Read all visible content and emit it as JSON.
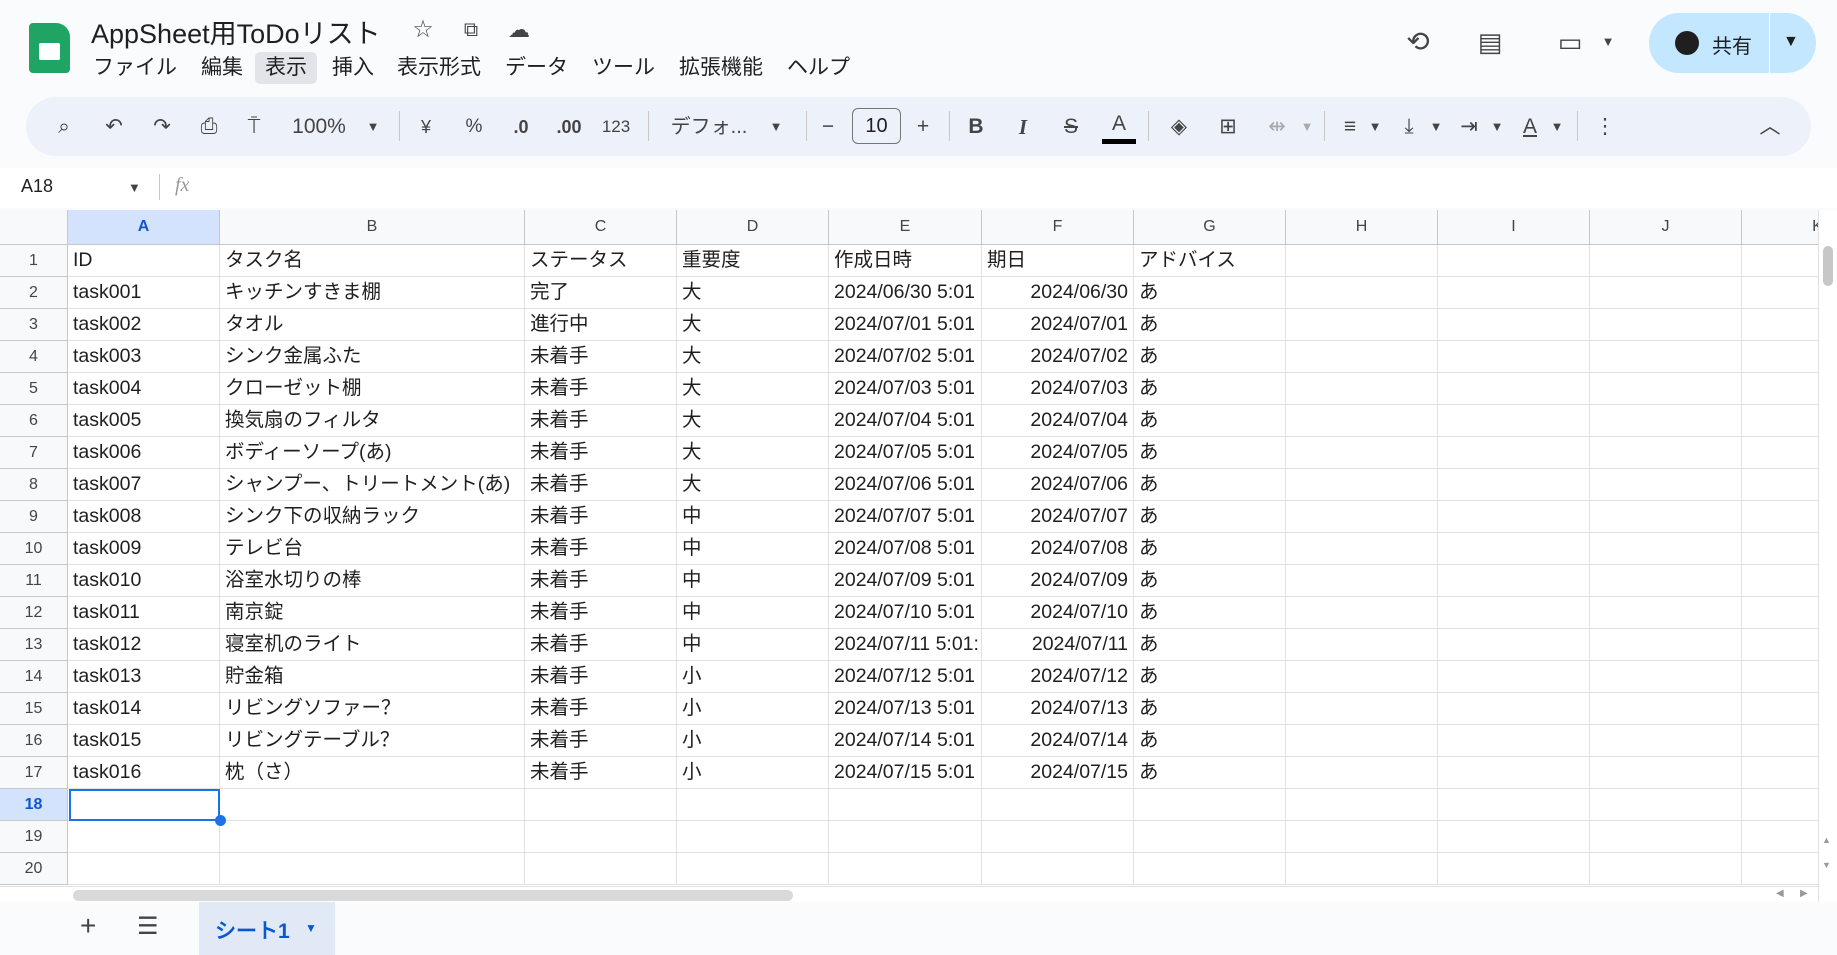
{
  "app": {
    "title": "AppSheet用ToDoリスト",
    "share_label": "共有"
  },
  "menu": [
    "ファイル",
    "編集",
    "表示",
    "挿入",
    "表示形式",
    "データ",
    "ツール",
    "拡張機能",
    "ヘルプ"
  ],
  "toolbar": {
    "zoom": "100%",
    "currency": "¥",
    "percent": "%",
    "dec_decrease": ".0",
    "dec_increase": ".00",
    "number_format": "123",
    "font": "デフォ...",
    "font_size": "10",
    "bold": "B",
    "italic": "I",
    "text_color": "A"
  },
  "formula_bar": {
    "cell_ref": "A18",
    "fx": "fx",
    "value": ""
  },
  "columns": [
    "A",
    "B",
    "C",
    "D",
    "E",
    "F",
    "G",
    "H",
    "I",
    "J",
    "K"
  ],
  "row_numbers": [
    "1",
    "2",
    "3",
    "4",
    "5",
    "6",
    "7",
    "8",
    "9",
    "10",
    "11",
    "12",
    "13",
    "14",
    "15",
    "16",
    "17",
    "18",
    "19",
    "20"
  ],
  "rows": [
    [
      "ID",
      "タスク名",
      "ステータス",
      "重要度",
      "作成日時",
      "期日",
      "アドバイス"
    ],
    [
      "task001",
      "キッチンすきま棚",
      "完了",
      "大",
      "2024/06/30 5:01",
      "2024/06/30",
      "あ"
    ],
    [
      "task002",
      "タオル",
      "進行中",
      "大",
      "2024/07/01 5:01",
      "2024/07/01",
      "あ"
    ],
    [
      "task003",
      "シンク金属ふた",
      "未着手",
      "大",
      "2024/07/02 5:01",
      "2024/07/02",
      "あ"
    ],
    [
      "task004",
      "クローゼット棚",
      "未着手",
      "大",
      "2024/07/03 5:01",
      "2024/07/03",
      "あ"
    ],
    [
      "task005",
      "換気扇のフィルタ",
      "未着手",
      "大",
      "2024/07/04 5:01",
      "2024/07/04",
      "あ"
    ],
    [
      "task006",
      "ボディーソープ(あ)",
      "未着手",
      "大",
      "2024/07/05 5:01",
      "2024/07/05",
      "あ"
    ],
    [
      "task007",
      "シャンプー、トリートメント(あ)",
      "未着手",
      "大",
      "2024/07/06 5:01",
      "2024/07/06",
      "あ"
    ],
    [
      "task008",
      "シンク下の収納ラック",
      "未着手",
      "中",
      "2024/07/07 5:01",
      "2024/07/07",
      "あ"
    ],
    [
      "task009",
      "テレビ台",
      "未着手",
      "中",
      "2024/07/08 5:01",
      "2024/07/08",
      "あ"
    ],
    [
      "task010",
      "浴室水切りの棒",
      "未着手",
      "中",
      "2024/07/09 5:01",
      "2024/07/09",
      "あ"
    ],
    [
      "task011",
      "南京錠",
      "未着手",
      "中",
      "2024/07/10 5:01",
      "2024/07/10",
      "あ"
    ],
    [
      "task012",
      "寝室机のライト",
      "未着手",
      "中",
      "2024/07/11 5:01:",
      "2024/07/11",
      "あ"
    ],
    [
      "task013",
      "貯金箱",
      "未着手",
      "小",
      "2024/07/12 5:01",
      "2024/07/12",
      "あ"
    ],
    [
      "task014",
      "リビングソファー？",
      "未着手",
      "小",
      "2024/07/13 5:01",
      "2024/07/13",
      "あ"
    ],
    [
      "task015",
      "リビングテーブル？",
      "未着手",
      "小",
      "2024/07/14 5:01",
      "2024/07/14",
      "あ"
    ],
    [
      "task016",
      "枕（さ）",
      "未着手",
      "小",
      "2024/07/15 5:01",
      "2024/07/15",
      "あ"
    ]
  ],
  "selected_cell": "A18",
  "sheet_tabs": [
    {
      "label": "シート1",
      "active": true
    }
  ],
  "colors": {
    "accent": "#0b57d0",
    "share_bg": "#c2e7ff",
    "toolbar_bg": "#edf2fa",
    "selected_header": "#d3e3fd"
  }
}
